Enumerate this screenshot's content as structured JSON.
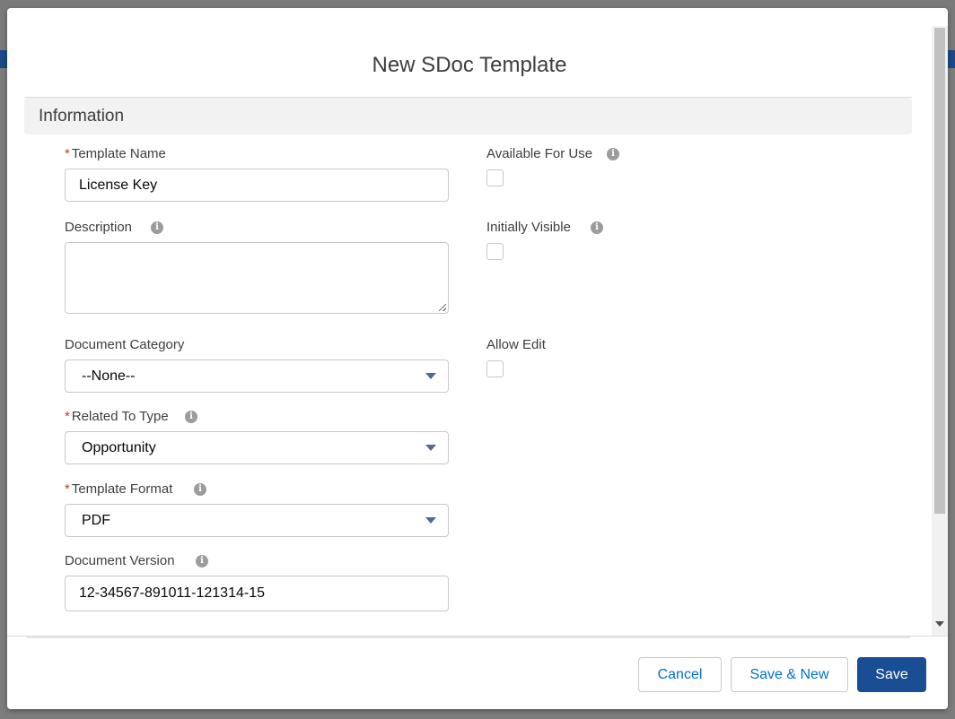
{
  "modal": {
    "title": "New SDoc Template",
    "section_title": "Information"
  },
  "fields": {
    "template_name": {
      "label": "Template Name",
      "required_mark": "*",
      "value": "License Key"
    },
    "description": {
      "label": "Description",
      "value": ""
    },
    "document_category": {
      "label": "Document Category",
      "value": "--None--"
    },
    "related_to_type": {
      "label": "Related To Type",
      "required_mark": "*",
      "value": "Opportunity"
    },
    "template_format": {
      "label": "Template Format",
      "required_mark": "*",
      "value": "PDF"
    },
    "document_version": {
      "label": "Document Version",
      "value": "12-34567-891011-121314-15"
    },
    "available_for_use": {
      "label": "Available For Use",
      "checked": false
    },
    "initially_visible": {
      "label": "Initially Visible",
      "checked": false
    },
    "allow_edit": {
      "label": "Allow Edit",
      "checked": false
    }
  },
  "footer": {
    "cancel_label": "Cancel",
    "save_new_label": "Save & New",
    "save_label": "Save"
  },
  "icons": {
    "info": "info-icon",
    "dropdown": "chevron-down-icon"
  },
  "colors": {
    "brand": "#1a4e94",
    "link": "#0070d2",
    "required": "#c23934",
    "section_bg": "#f3f2f2"
  }
}
